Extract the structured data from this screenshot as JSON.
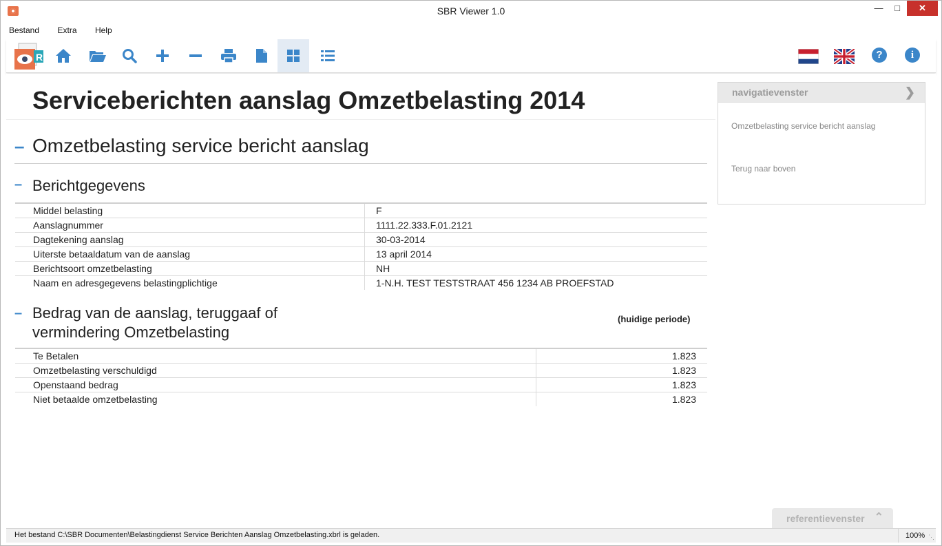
{
  "window": {
    "title": "SBR Viewer 1.0"
  },
  "menu": [
    "Bestand",
    "Extra",
    "Help"
  ],
  "toolbar": {
    "buttons": [
      "home-icon",
      "folder-open-icon",
      "search-icon",
      "zoom-in-icon",
      "zoom-out-icon",
      "print-icon",
      "document-icon",
      "grid-view-icon",
      "list-view-icon"
    ],
    "active": "grid-view-icon",
    "right": [
      "flag-nl-icon",
      "flag-uk-icon",
      "help-icon",
      "info-icon"
    ]
  },
  "page": {
    "title": "Serviceberichten aanslag Omzetbelasting 2014",
    "section_title": "Omzetbelasting service bericht aanslag",
    "berichtgegevens": {
      "title": "Berichtgegevens",
      "rows": [
        {
          "label": "Middel belasting",
          "value": "F"
        },
        {
          "label": "Aanslagnummer",
          "value": "1111.22.333.F.01.2121"
        },
        {
          "label": "Dagtekening aanslag",
          "value": "30-03-2014"
        },
        {
          "label": "Uiterste betaaldatum van de aanslag",
          "value": "13 april 2014"
        },
        {
          "label": "Berichtsoort omzetbelasting",
          "value": "NH"
        },
        {
          "label": "Naam en adresgegevens belastingplichtige",
          "value": "1-N.H. TEST TESTSTRAAT 456 1234 AB PROEFSTAD"
        }
      ]
    },
    "bedrag": {
      "title_line1": "Bedrag van de aanslag, teruggaaf of",
      "title_line2": "vermindering Omzetbelasting",
      "period_header": "(huidige periode)",
      "rows": [
        {
          "label": "Te Betalen",
          "value": "1.823"
        },
        {
          "label": "Omzetbelasting verschuldigd",
          "value": "1.823"
        },
        {
          "label": "Openstaand bedrag",
          "value": "1.823"
        },
        {
          "label": "Niet betaalde omzetbelasting",
          "value": "1.823"
        }
      ]
    }
  },
  "nav_panel": {
    "title": "navigatievenster",
    "links": [
      "Omzetbelasting service bericht aanslag",
      "Terug naar boven"
    ]
  },
  "ref_panel": {
    "title": "referentievenster"
  },
  "status": {
    "message": "Het bestand C:\\SBR Documenten\\Belastingdienst Service Berichten Aanslag Omzetbelasting.xbrl is geladen.",
    "zoom": "100%"
  },
  "colors": {
    "accent": "#3b86c9",
    "close": "#c7312b"
  }
}
